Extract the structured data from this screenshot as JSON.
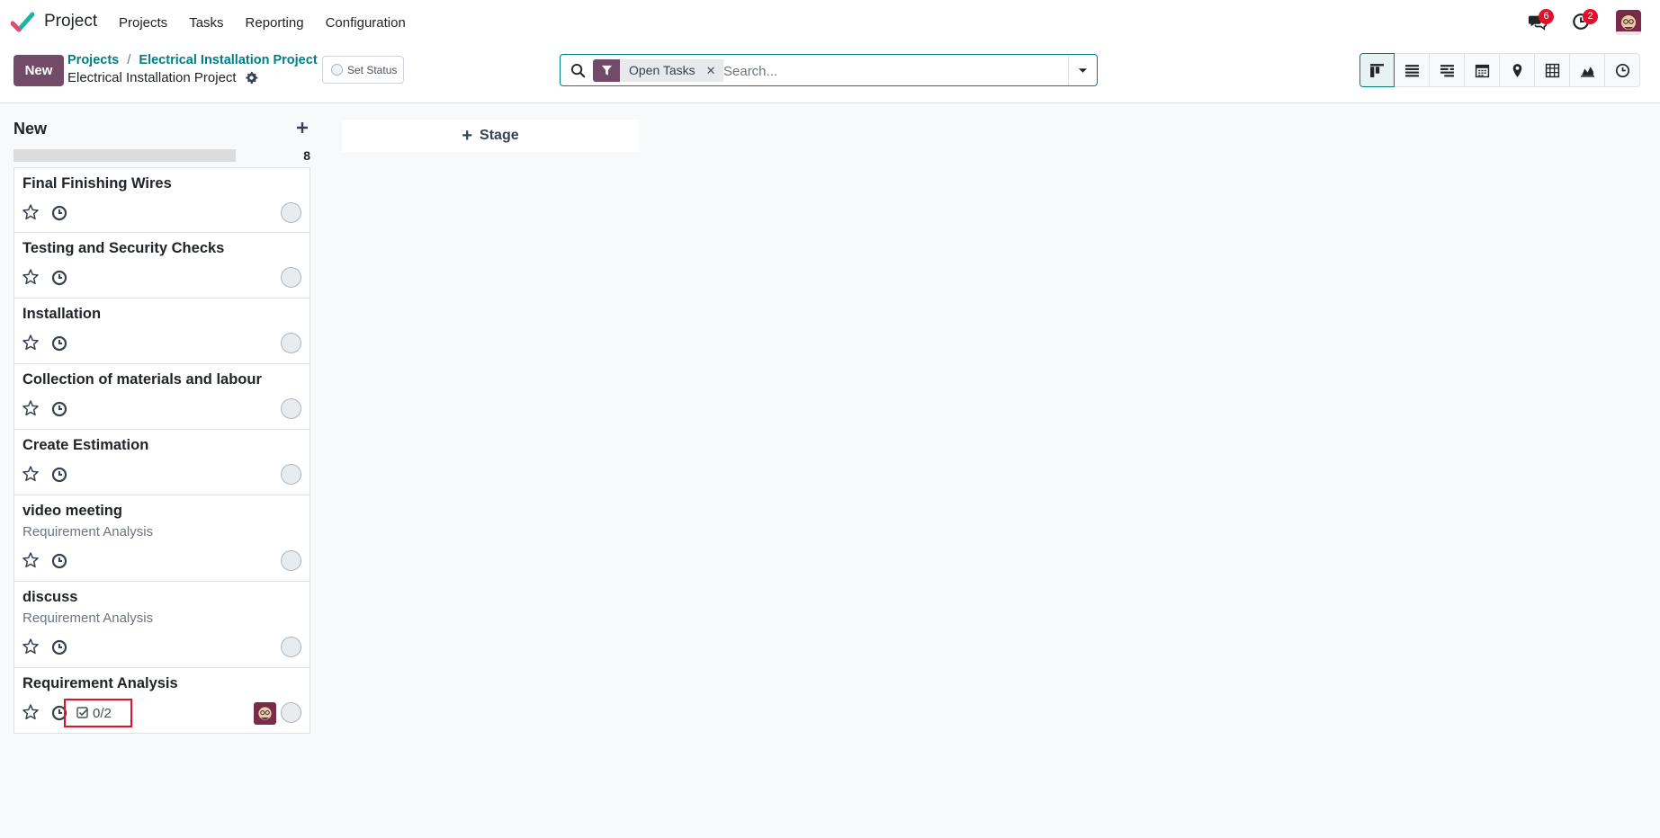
{
  "app": {
    "name": "Project",
    "brand_color": "#714b67",
    "accent_color": "#017e84"
  },
  "navbar": {
    "menu": [
      "Projects",
      "Tasks",
      "Reporting",
      "Configuration"
    ],
    "messages_count": "6",
    "activities_count": "2"
  },
  "control_panel": {
    "new_label": "New",
    "breadcrumb": [
      "Projects",
      "Electrical Installation Project"
    ],
    "current": "Electrical Installation Project",
    "set_status_label": "Set Status",
    "search": {
      "facet": "Open Tasks",
      "placeholder": "Search..."
    },
    "views": [
      "kanban-view-icon",
      "list-view-icon",
      "gantt-view-icon",
      "calendar-view-icon",
      "map-view-icon",
      "pivot-view-icon",
      "graph-view-icon",
      "activity-view-icon"
    ]
  },
  "kanban": {
    "column": {
      "title": "New",
      "count": "8"
    },
    "add_stage_label": "Stage",
    "cards": [
      {
        "title": "Final Finishing Wires",
        "subtitle": ""
      },
      {
        "title": "Testing and Security Checks",
        "subtitle": ""
      },
      {
        "title": "Installation",
        "subtitle": ""
      },
      {
        "title": "Collection of materials and labour",
        "subtitle": ""
      },
      {
        "title": "Create Estimation",
        "subtitle": ""
      },
      {
        "title": "video meeting",
        "subtitle": "Requirement Analysis"
      },
      {
        "title": "discuss",
        "subtitle": "Requirement Analysis"
      },
      {
        "title": "Requirement Analysis",
        "subtitle": "",
        "checklist": "0/2"
      }
    ]
  }
}
